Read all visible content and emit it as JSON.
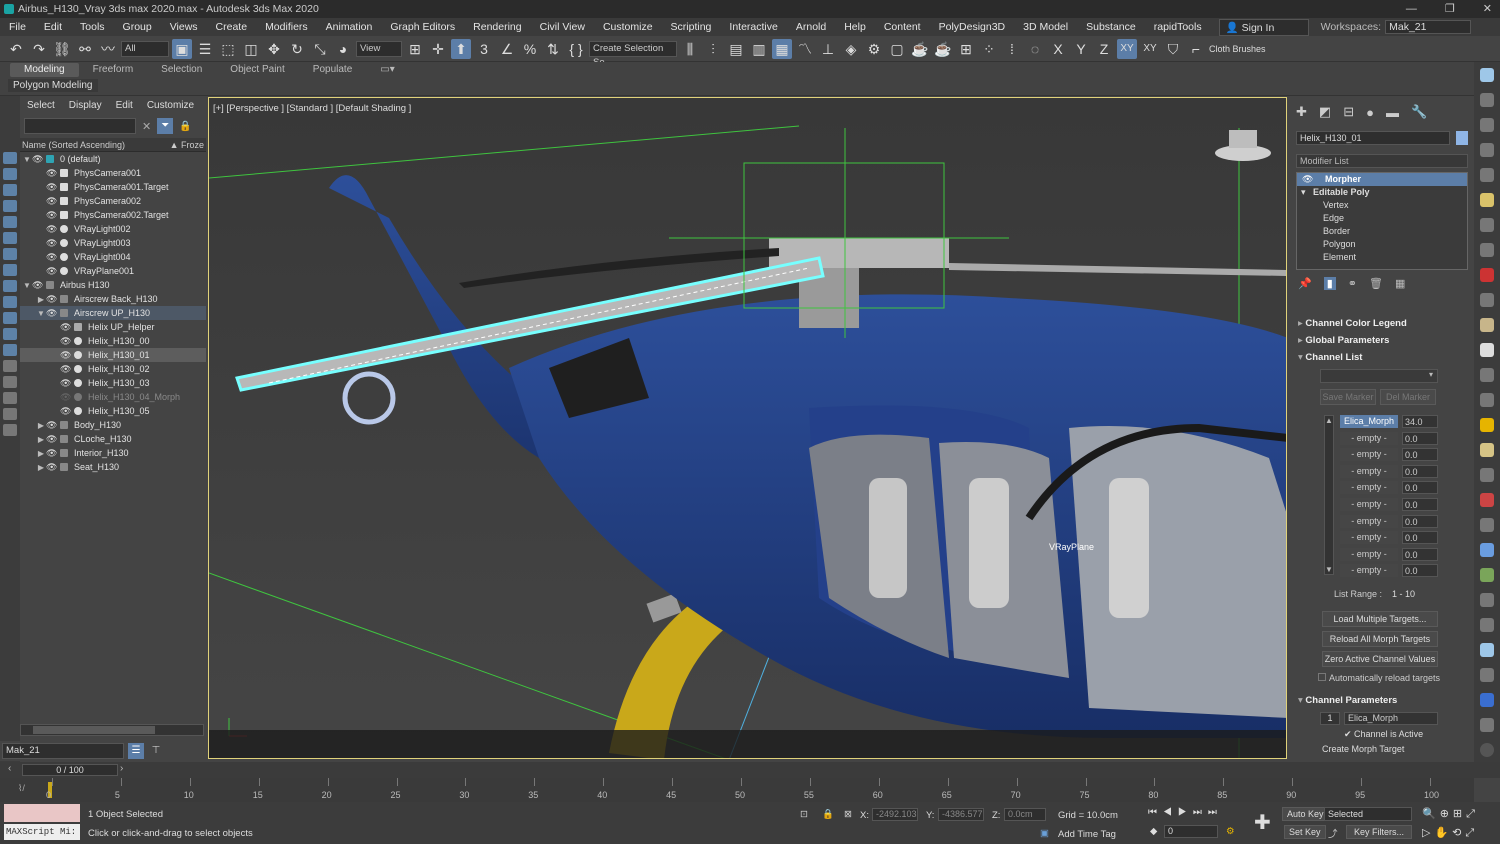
{
  "titlebar": {
    "title": "Airbus_H130_Vray 3ds max 2020.max - Autodesk 3ds Max 2020",
    "min": "—",
    "max": "❐",
    "close": "✕"
  },
  "menu": {
    "items": [
      "File",
      "Edit",
      "Tools",
      "Group",
      "Views",
      "Create",
      "Modifiers",
      "Animation",
      "Graph Editors",
      "Rendering",
      "Civil View",
      "Customize",
      "Scripting",
      "Interactive",
      "Arnold",
      "Help",
      "Content",
      "PolyDesign3D",
      "3D Model",
      "Substance",
      "rapidTools"
    ],
    "sign_in": "Sign In",
    "workspaces_label": "Workspaces:",
    "workspace": "Mak_21"
  },
  "toolbar": {
    "filter": "All",
    "view": "View",
    "selection_set": "Create Selection Se",
    "axes": [
      "X",
      "Y",
      "Z",
      "XY",
      "XY"
    ],
    "cloth_brushes": "Cloth Brushes"
  },
  "ribbon": {
    "tabs": [
      "Modeling",
      "Freeform",
      "Selection",
      "Object Paint",
      "Populate"
    ],
    "sub": "Polygon Modeling"
  },
  "scene": {
    "menu": [
      "Select",
      "Display",
      "Edit",
      "Customize"
    ],
    "header_name": "Name (Sorted Ascending)",
    "header_froze": "▲ Froze",
    "rows": [
      {
        "label": "0 (default)"
      },
      {
        "label": "PhysCamera001"
      },
      {
        "label": "PhysCamera001.Target"
      },
      {
        "label": "PhysCamera002"
      },
      {
        "label": "PhysCamera002.Target"
      },
      {
        "label": "VRayLight002"
      },
      {
        "label": "VRayLight003"
      },
      {
        "label": "VRayLight004"
      },
      {
        "label": "VRayPlane001"
      },
      {
        "label": "Airbus H130"
      },
      {
        "label": "Airscrew Back_H130"
      },
      {
        "label": "Airscrew UP_H130"
      },
      {
        "label": "Helix UP_Helper"
      },
      {
        "label": "Helix_H130_00"
      },
      {
        "label": "Helix_H130_01"
      },
      {
        "label": "Helix_H130_02"
      },
      {
        "label": "Helix_H130_03"
      },
      {
        "label": "Helix_H130_04_Morph"
      },
      {
        "label": "Helix_H130_05"
      },
      {
        "label": "Body_H130"
      },
      {
        "label": "CLoche_H130"
      },
      {
        "label": "Interior_H130"
      },
      {
        "label": "Seat_H130"
      }
    ],
    "layer": "Mak_21"
  },
  "viewport": {
    "label": "[+] [Perspective ] [Standard ] [Default Shading ]",
    "vrayplane": "VRayPlane"
  },
  "command_panel": {
    "object_name": "Helix_H130_01",
    "modifier_list": "Modifier List",
    "stack": [
      "Morpher",
      "Editable Poly",
      "Vertex",
      "Edge",
      "Border",
      "Polygon",
      "Element"
    ],
    "rollouts": {
      "color_legend": "Channel Color Legend",
      "global": "Global Parameters",
      "channel_list": "Channel List",
      "channel_params": "Channel Parameters"
    },
    "save_marker": "Save Marker",
    "del_marker": "Del Marker",
    "channels": [
      {
        "name": "Elica_Morph",
        "value": "34.0"
      },
      {
        "name": "- empty -",
        "value": "0.0"
      },
      {
        "name": "- empty -",
        "value": "0.0"
      },
      {
        "name": "- empty -",
        "value": "0.0"
      },
      {
        "name": "- empty -",
        "value": "0.0"
      },
      {
        "name": "- empty -",
        "value": "0.0"
      },
      {
        "name": "- empty -",
        "value": "0.0"
      },
      {
        "name": "- empty -",
        "value": "0.0"
      },
      {
        "name": "- empty -",
        "value": "0.0"
      },
      {
        "name": "- empty -",
        "value": "0.0"
      }
    ],
    "list_range_label": "List Range :",
    "list_range": "1 - 10",
    "load_multiple": "Load Multiple Targets...",
    "reload_all": "Reload All Morph Targets",
    "zero_active": "Zero Active Channel Values",
    "auto_reload": "Automatically reload targets",
    "channel_number": "1",
    "channel_name": "Elica_Morph",
    "channel_active": "Channel is Active",
    "create_target": "Create Morph Target"
  },
  "timeline": {
    "slider": "0 / 100",
    "ticks": [
      "0",
      "5",
      "10",
      "15",
      "20",
      "25",
      "30",
      "35",
      "40",
      "45",
      "50",
      "55",
      "60",
      "65",
      "70",
      "75",
      "80",
      "85",
      "90",
      "95",
      "100"
    ]
  },
  "status": {
    "maxscript": "MAXScript Mi:",
    "selected": "1 Object Selected",
    "hint": "Click or click-and-drag to select objects",
    "x_label": "X:",
    "x": "-2492.103",
    "y_label": "Y:",
    "y": "-4386.577",
    "z_label": "Z:",
    "z": "0.0cm",
    "grid": "Grid = 10.0cm",
    "add_time_tag": "Add Time Tag",
    "auto_key": "Auto Key",
    "set_key": "Set Key",
    "selected_mode": "Selected",
    "key_filters": "Key Filters...",
    "frame": "0"
  }
}
